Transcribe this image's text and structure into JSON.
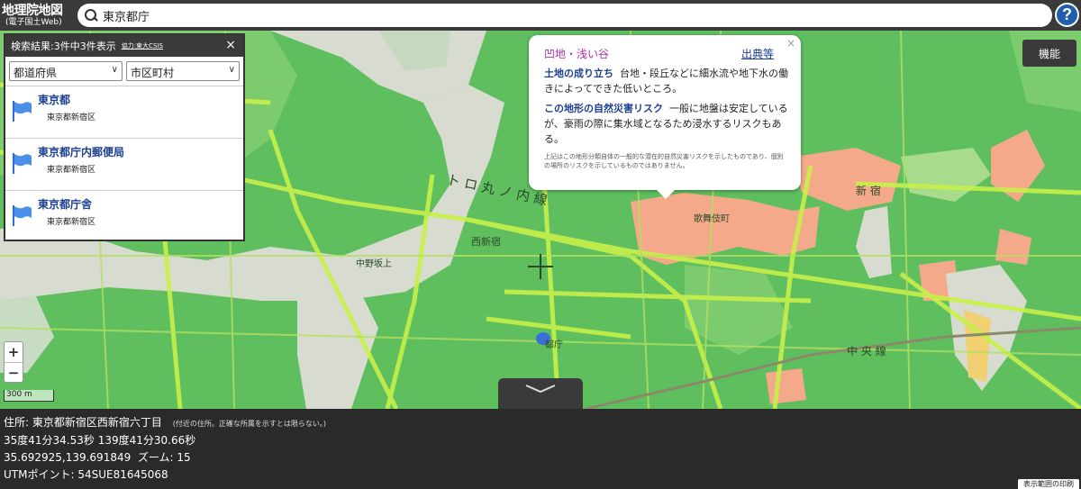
{
  "header": {
    "logo_main": "地理院地図",
    "logo_sub": "(電子国土Web)",
    "search_value": "東京都庁",
    "help_label": "?"
  },
  "results": {
    "header": "検索結果:3件中3件表示",
    "credit": "協力:東大CSIS",
    "close": "×",
    "prefecture_select": "都道府県",
    "city_select": "市区町村",
    "items": [
      {
        "title": "東京都",
        "sub": "東京都新宿区"
      },
      {
        "title": "東京都庁内郵便局",
        "sub": "東京都新宿区"
      },
      {
        "title": "東京都庁舎",
        "sub": "東京都新宿区"
      }
    ]
  },
  "popup": {
    "title": "凹地・浅い谷",
    "source_link": "出典等",
    "close": "×",
    "p1_head": "土地の成り立ち",
    "p1_body": "台地・段丘などに細水流や地下水の働きによってできた低いところ。",
    "p2_head": "この地形の自然災害リスク",
    "p2_body": "一般に地盤は安定しているが、豪雨の際に集水域となるため浸水するリスクもある。",
    "note": "上記はこの地形分類自体の一般的な潜在的自然災害リスクを示したものであり、個別の場所のリスクを示しているものではありません。"
  },
  "controls": {
    "function_button": "機能",
    "zoom_in": "+",
    "zoom_out": "−",
    "scale": "300 m"
  },
  "info": {
    "address_label": "住所:",
    "address": "東京都新宿区西新宿六丁目",
    "address_note": "(付近の住所。正確な所属を示すとは限らない。)",
    "dms": "35度41分34.53秒 139度41分30.66秒",
    "decimal": "35.692925,139.691849",
    "zoom_label": "ズーム: 15",
    "utm": "UTMポイント: 54SUE81645068",
    "copy_button": "表示範囲の印刷"
  },
  "map_labels": {
    "marunouchi": "ト ロ 丸 ノ 内 線",
    "nishi_shinjuku": "西新宿",
    "shinjuku": "新 宿",
    "chuo": "中 央 線",
    "kabukicho": "歌舞伎町",
    "tocho": "都庁",
    "nakano": "中野坂上"
  },
  "colors": {
    "land_green": "#5fbf5f",
    "light_green": "#a8dc8c",
    "valley_pink": "#f4a98a",
    "terrace_gray": "#d8dcd0",
    "road_yellow": "#c8f04a",
    "header_dark": "#3a3a3a",
    "link_blue": "#1a3f8f",
    "title_magenta": "#b02fb0"
  }
}
